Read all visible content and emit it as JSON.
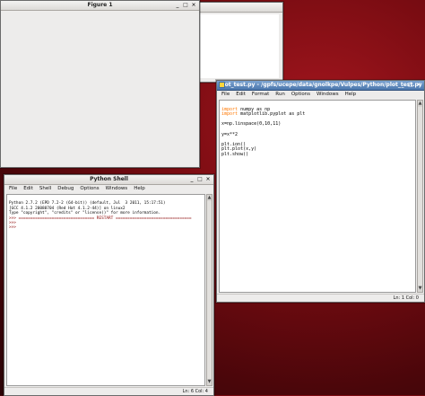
{
  "figure1": {
    "title": "Figure 1",
    "min_glyph": "_",
    "max_glyph": "□",
    "close_glyph": "×"
  },
  "editor": {
    "title": "plot_test.py - /gpfs/ucepe/data/gnolkpe/Vulpes/Python/plot_test.py",
    "min_glyph": "_",
    "max_glyph": "□",
    "close_glyph": "×",
    "menu": [
      "File",
      "Edit",
      "Format",
      "Run",
      "Options",
      "Windows",
      "Help"
    ],
    "code": [
      {
        "kw": "import",
        "rest": " numpy as np"
      },
      {
        "kw": "import",
        "rest": " matplotlib.pyplot as plt"
      },
      {
        "kw": "",
        "rest": ""
      },
      {
        "kw": "",
        "rest": "x=np.linspace(0,10,11)"
      },
      {
        "kw": "",
        "rest": ""
      },
      {
        "kw": "",
        "rest": "y=x**2"
      },
      {
        "kw": "",
        "rest": ""
      },
      {
        "kw": "",
        "rest": "plt.ion()"
      },
      {
        "kw": "",
        "rest": "plt.plot(x,y)"
      },
      {
        "kw": "",
        "rest": "plt.show()"
      }
    ],
    "status": "Ln: 1 Col: 0"
  },
  "shell": {
    "title": "Python Shell",
    "min_glyph": "_",
    "max_glyph": "□",
    "close_glyph": "×",
    "menu": [
      "File",
      "Edit",
      "Shell",
      "Debug",
      "Options",
      "Windows",
      "Help"
    ],
    "lines": [
      "Python 2.7.2 (EPD 7.2-2 (64-bit)) (default, Jul  3 2011, 15:17:51)",
      "[GCC 4.1.2 20080704 (Red Hat 4.1.2-44)] on linux2",
      "Type \"copyright\", \"credits\" or \"license()\" for more information.",
      ">>> ================================ RESTART ================================",
      ">>>",
      ">>>"
    ],
    "status": "Ln: 6 Col: 4"
  },
  "scroll": {
    "up": "▲",
    "down": "▼"
  }
}
